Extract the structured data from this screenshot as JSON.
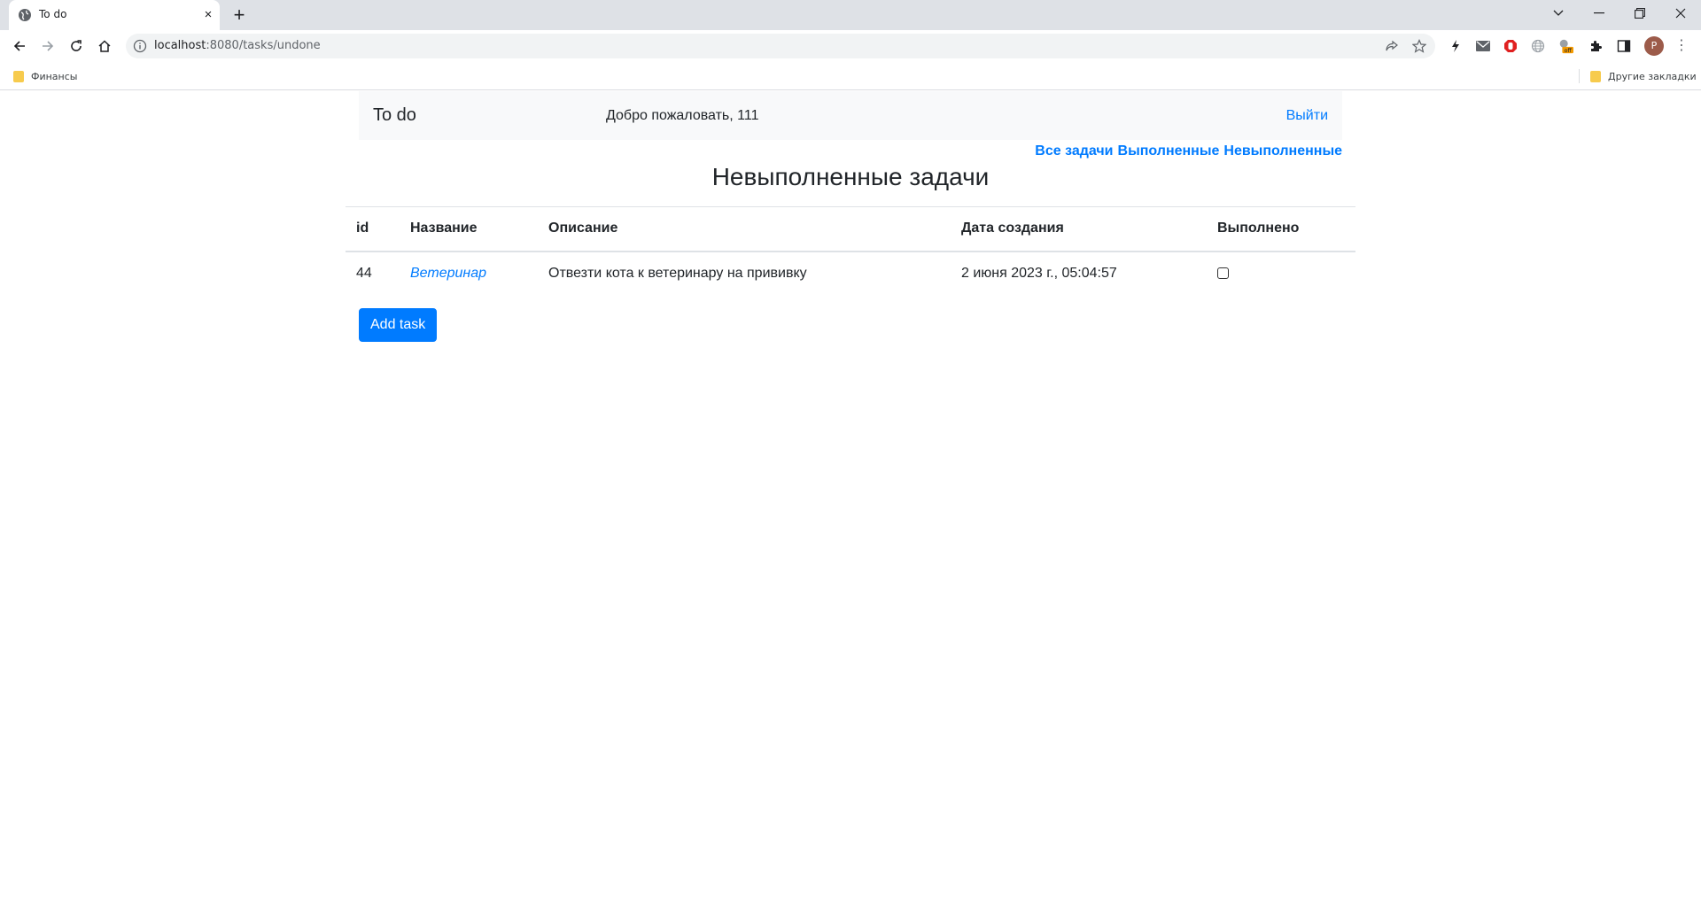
{
  "browser": {
    "tab_title": "To do",
    "tab_close": "×",
    "new_tab": "+",
    "url_host": "localhost",
    "url_path": ":8080/tasks/undone",
    "profile_initial": "P",
    "menu": "⋮",
    "bookmarks": [
      {
        "label": "Финансы"
      }
    ],
    "other_bookmarks": "Другие закладки",
    "extension_badge": "off"
  },
  "navbar": {
    "brand": "To do",
    "welcome": "Добро пожаловать, 111",
    "logout": "Выйти"
  },
  "filters": {
    "all": "Все задачи",
    "done": "Выполненные",
    "undone": "Невыполненные"
  },
  "heading": "Невыполненные задачи",
  "table": {
    "headers": [
      "id",
      "Название",
      "Описание",
      "Дата создания",
      "Выполнено"
    ],
    "rows": [
      {
        "id": "44",
        "name": "Ветеринар",
        "description": "Отвезти кота к ветеринару на прививку",
        "created": "2 июня 2023 г., 05:04:57",
        "done": false
      }
    ]
  },
  "add_button": "Add task",
  "colors": {
    "link": "#007bff",
    "navbar_bg": "#f8f9fa",
    "tabstrip_bg": "#dee1e6"
  }
}
